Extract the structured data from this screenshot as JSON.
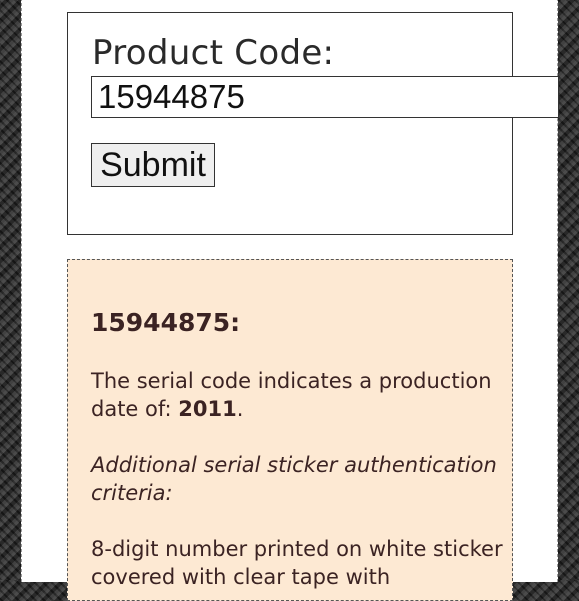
{
  "form": {
    "label": "Product Code:",
    "input_value": "15944875",
    "submit_label": "Submit"
  },
  "result": {
    "code_heading": "15944875:",
    "description_prefix": "The serial code indicates a production date of: ",
    "production_year": "2011",
    "description_suffix": ".",
    "criteria_text": "Additional serial sticker authentication criteria:",
    "details_text": "8-digit number printed on white sticker covered with clear tape with"
  }
}
